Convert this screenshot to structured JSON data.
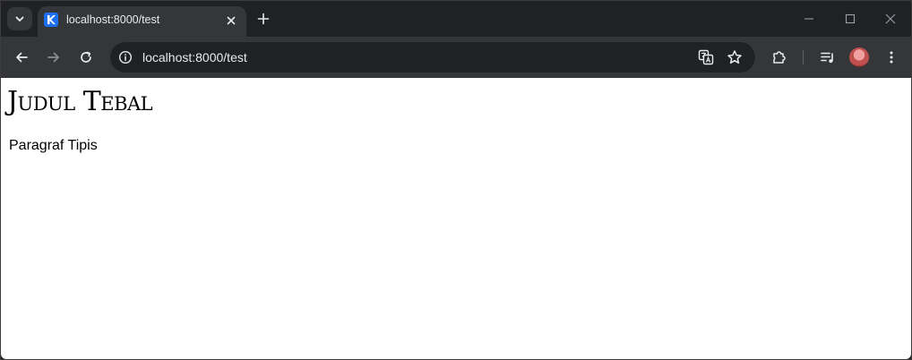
{
  "browser": {
    "tab": {
      "title": "localhost:8000/test",
      "favicon": "brand-k-icon",
      "favicon_color": "#1e6ff0"
    },
    "address_bar": {
      "url": "localhost:8000/test"
    },
    "icons": {
      "tab_search": "chevron-down-icon",
      "tab_close": "close-icon",
      "new_tab": "plus-icon",
      "minimize": "minimize-icon",
      "maximize": "maximize-icon",
      "close_window": "close-icon",
      "back": "arrow-left-icon",
      "forward": "arrow-right-icon",
      "reload": "reload-icon",
      "site_info": "info-icon",
      "translate": "translate-icon",
      "bookmark": "star-icon",
      "extensions": "puzzle-icon",
      "media_controls": "playlist-icon",
      "profile": "avatar",
      "menu": "more-vert-icon"
    },
    "colors": {
      "frame": "#202124",
      "toolbar": "#35363a",
      "text": "#e8eaed"
    }
  },
  "page": {
    "heading": "Judul Tebal",
    "paragraph": "Paragraf Tipis"
  }
}
